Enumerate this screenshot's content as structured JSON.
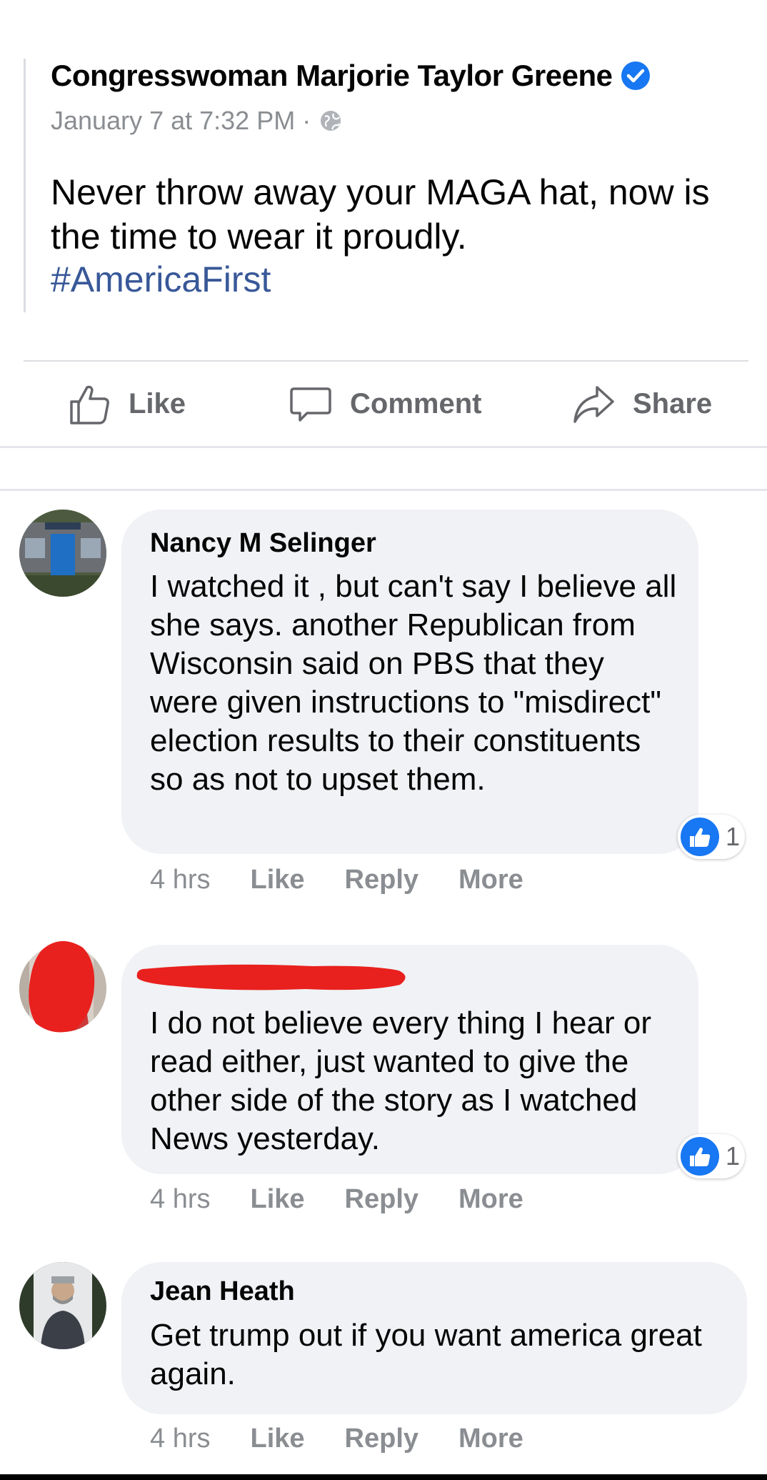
{
  "post": {
    "author": "Congresswoman Marjorie Taylor Greene",
    "verified_icon": "verified-badge-icon",
    "timestamp": "January 7 at 7:32 PM",
    "separator": "·",
    "audience_icon": "globe-icon",
    "text": "Never throw away your MAGA hat, now is the time to wear it proudly.",
    "hashtag": "#AmericaFirst"
  },
  "actions": {
    "like": "Like",
    "comment": "Comment",
    "share": "Share"
  },
  "comments": [
    {
      "author": "Nancy M Selinger",
      "text": "I watched it , but can't say I believe all she says. another Republican from Wisconsin said on PBS that they were given instructions to \"misdirect\" election results to their constituents so as not to upset them.",
      "reaction_count": "1",
      "time": "4 hrs",
      "like": "Like",
      "reply": "Reply",
      "more": "More"
    },
    {
      "author": "",
      "redacted": true,
      "text": "I do not believe every thing I hear or read either, just wanted to give the other side of the story as I watched News yesterday.",
      "reaction_count": "1",
      "time": "4 hrs",
      "like": "Like",
      "reply": "Reply",
      "more": "More"
    },
    {
      "author": "Jean Heath",
      "text": "Get trump out if you want america great again.",
      "time": "4 hrs",
      "like": "Like",
      "reply": "Reply",
      "more": "More"
    }
  ],
  "colors": {
    "link": "#385898",
    "meta": "#8a8d91",
    "action": "#65676b",
    "bubble": "#f0f2f5",
    "like_blue": "#1877f2",
    "redaction": "#e8211e"
  }
}
